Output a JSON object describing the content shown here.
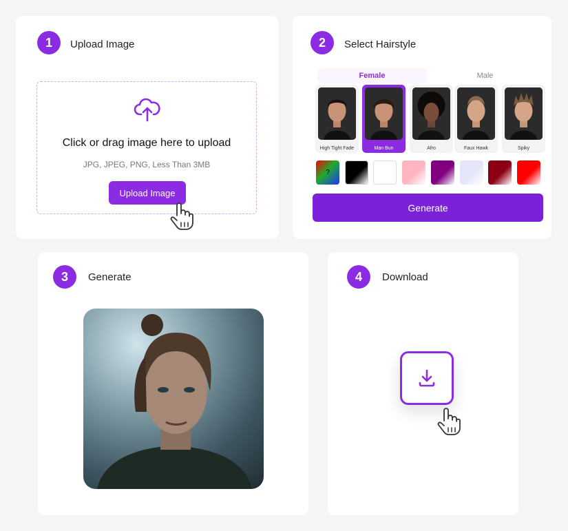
{
  "steps": [
    {
      "number": "1",
      "title": "Upload Image"
    },
    {
      "number": "2",
      "title": "Select Hairstyle"
    },
    {
      "number": "3",
      "title": "Generate"
    },
    {
      "number": "4",
      "title": "Download"
    }
  ],
  "upload": {
    "title": "Click or drag image here to upload",
    "subtitle": "JPG, JPEG, PNG, Less Than 3MB",
    "button_label": "Upload Image"
  },
  "hairstyle": {
    "tabs": [
      {
        "label": "Female",
        "active": true
      },
      {
        "label": "Male",
        "active": false
      }
    ],
    "styles": [
      {
        "label": "High Tight Fade",
        "selected": false
      },
      {
        "label": "Man Bun",
        "selected": true
      },
      {
        "label": "Afro",
        "selected": false
      },
      {
        "label": "Faux Hawk",
        "selected": false
      },
      {
        "label": "Spiky",
        "selected": false
      }
    ],
    "colors": [
      {
        "name": "random",
        "label": "?"
      },
      {
        "name": "black",
        "color": "#000000"
      },
      {
        "name": "white",
        "color": "#ffffff"
      },
      {
        "name": "pink",
        "color": "#ffb6c1"
      },
      {
        "name": "purple",
        "color": "#800080"
      },
      {
        "name": "lavender",
        "color": "#e6e6fa"
      },
      {
        "name": "dark-red",
        "color": "#8b0015"
      },
      {
        "name": "red",
        "color": "#ff0000"
      }
    ],
    "generate_label": "Generate"
  },
  "colors": {
    "accent": "#8b2be2",
    "generate_button": "#7b22d8",
    "dropzone_border": "#d3a9ef"
  }
}
